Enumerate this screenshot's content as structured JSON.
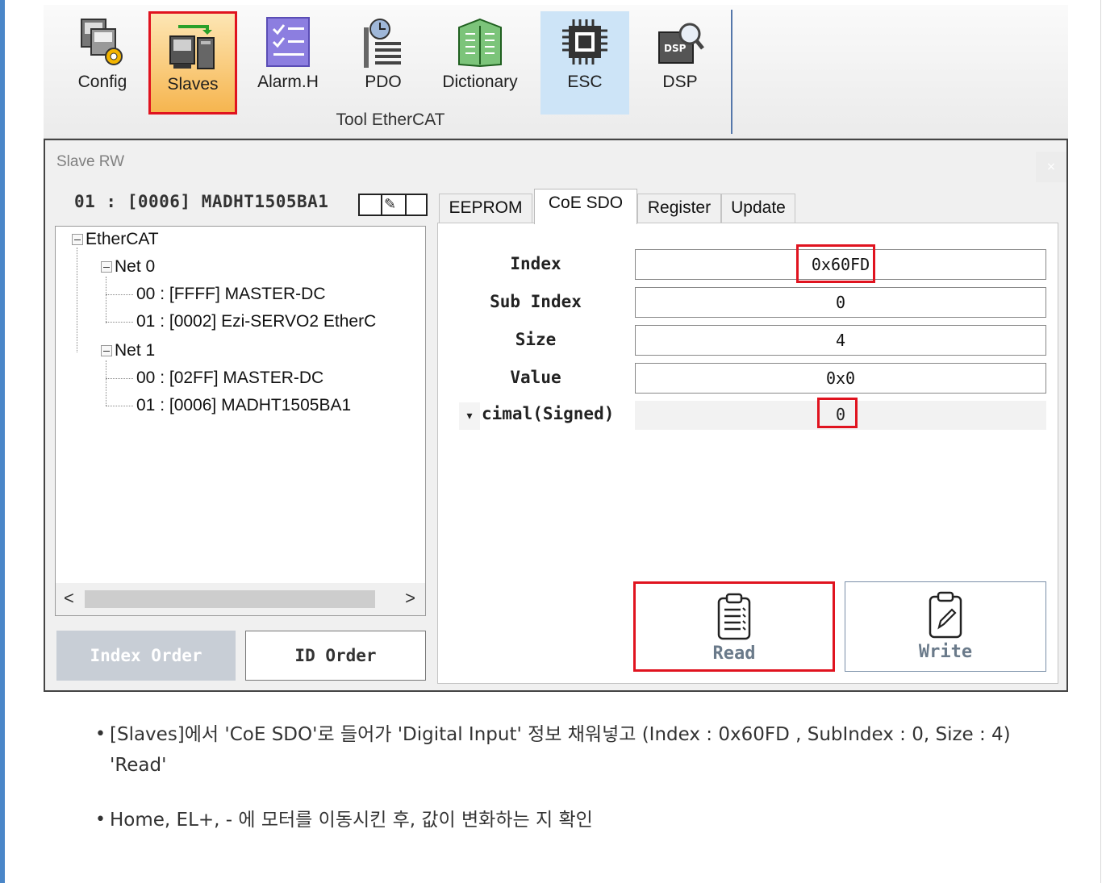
{
  "ribbon": {
    "buttons": [
      {
        "label": "Config",
        "icon": "config-icon"
      },
      {
        "label": "Slaves",
        "icon": "slaves-icon",
        "active": true
      },
      {
        "label": "Alarm.H",
        "icon": "alarm-list-icon"
      },
      {
        "label": "PDO",
        "icon": "pdo-icon"
      },
      {
        "label": "Dictionary",
        "icon": "dictionary-icon"
      },
      {
        "label": "ESC",
        "icon": "chip-icon",
        "selected": true
      },
      {
        "label": "DSP",
        "icon": "dsp-icon"
      }
    ],
    "group_label": "Tool EtherCAT"
  },
  "window": {
    "title": "Slave RW",
    "close_symbol": "×",
    "slave_header": "01 : [0006] MADHT1505BA1",
    "tree": {
      "root": "EtherCAT",
      "nets": [
        {
          "label": "Net 0",
          "children": [
            "00 : [FFFF] MASTER-DC",
            "01 : [0002] Ezi-SERVO2 EtherC"
          ]
        },
        {
          "label": "Net 1",
          "children": [
            "00 : [02FF] MASTER-DC",
            "01 : [0006] MADHT1505BA1"
          ]
        }
      ]
    },
    "scroll_left": "<",
    "scroll_right": ">",
    "index_order_label": "Index Order",
    "id_order_label": "ID Order",
    "tabs": [
      "EEPROM",
      "CoE SDO",
      "Register",
      "Update"
    ],
    "active_tab": "CoE SDO",
    "sdo": {
      "index_label": "Index",
      "index_value": "0x60FD",
      "subindex_label": "Sub Index",
      "subindex_value": "0",
      "size_label": "Size",
      "size_value": "4",
      "value_label": "Value",
      "value_value": "0x0",
      "format_label": "cimal(Signed)",
      "format_caret": "▾",
      "format_value": "0"
    },
    "read_label": "Read",
    "write_label": "Write"
  },
  "notes": [
    "[Slaves]에서 'CoE SDO'로 들어가 'Digital Input' 정보 채워넣고 (Index : 0x60FD , SubIndex : 0, Size : 4) 'Read'",
    "Home, EL+, - 에 모터를 이동시킨 후, 값이 변화하는 지 확인"
  ],
  "colors": {
    "accent_blue": "#4a86c8",
    "highlight_red": "#e0131f",
    "slaves_active": "#f6b54f",
    "esc_selected": "#cde4f7"
  }
}
